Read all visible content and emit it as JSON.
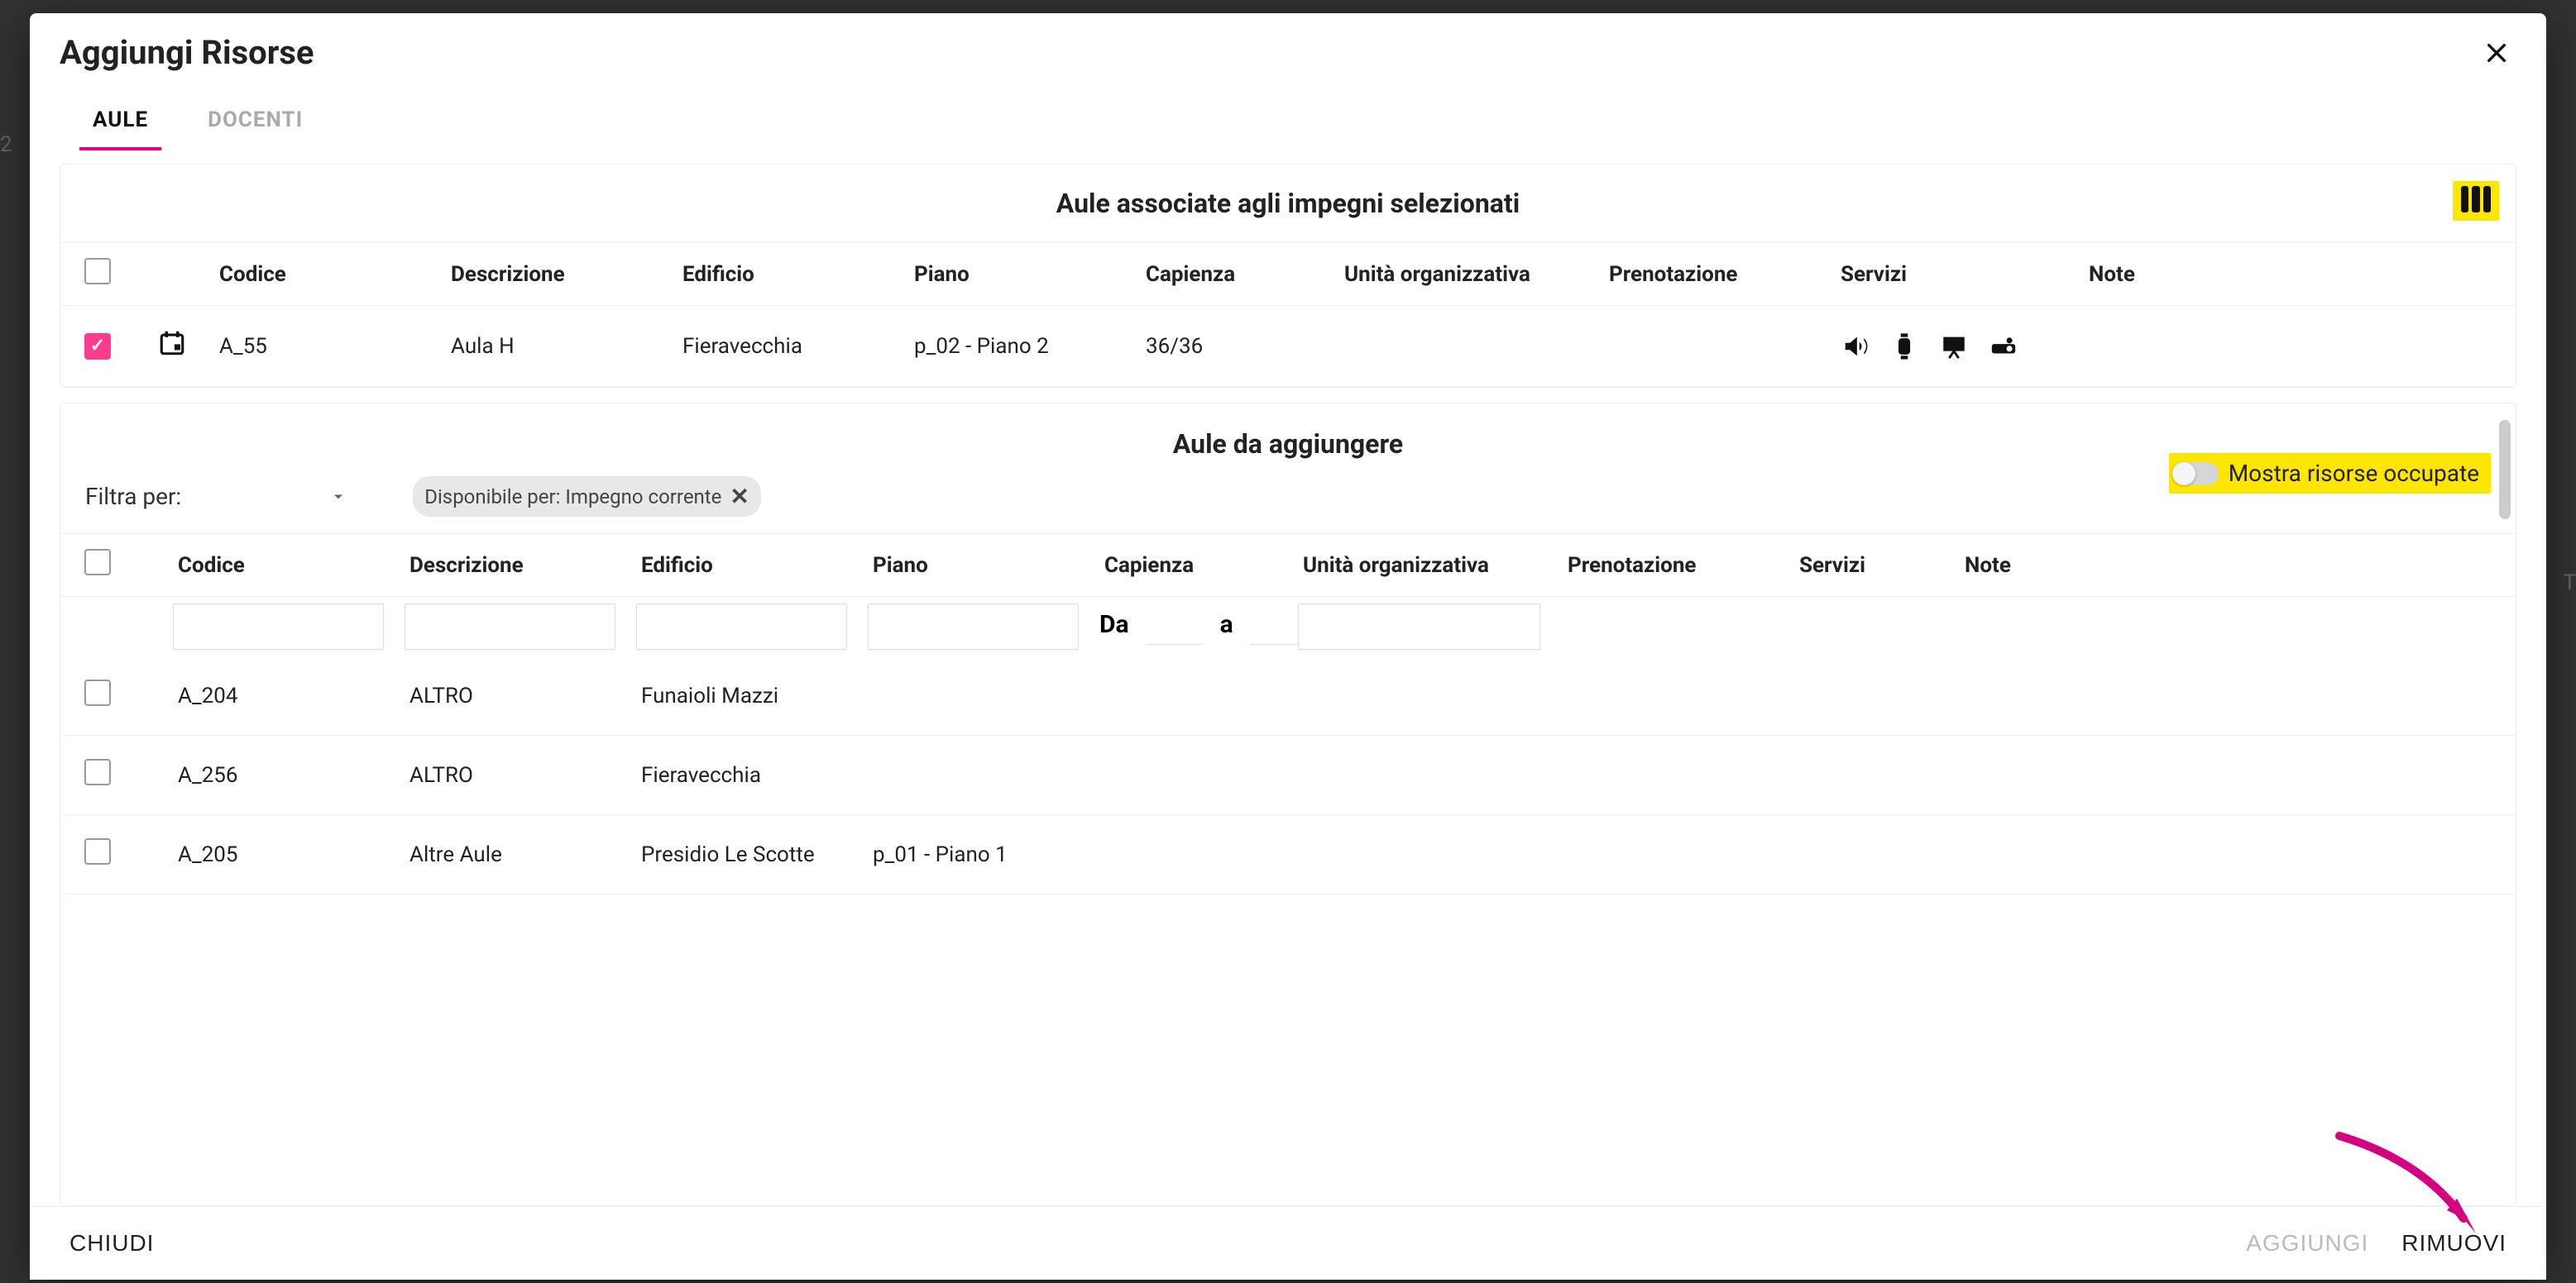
{
  "backdrop": {
    "left": "2",
    "right": "T"
  },
  "modal": {
    "title": "Aggiungi Risorse",
    "close_button": "✕"
  },
  "tabs": {
    "aule": "AULE",
    "docenti": "DOCENTI"
  },
  "panel_associated": {
    "title": "Aule associate agli impegni selezionati",
    "columns": {
      "codice": "Codice",
      "descrizione": "Descrizione",
      "edificio": "Edificio",
      "piano": "Piano",
      "capienza": "Capienza",
      "unita": "Unità organizzativa",
      "prenotazione": "Prenotazione",
      "servizi": "Servizi",
      "note": "Note"
    },
    "rows": [
      {
        "checked": true,
        "codice": "A_55",
        "descrizione": "Aula H",
        "edificio": "Fieravecchia",
        "piano": "p_02 - Piano 2",
        "capienza": "36/36"
      }
    ]
  },
  "panel_add": {
    "title": "Aule da aggiungere",
    "toggle_label": "Mostra risorse occupate",
    "filter_label": "Filtra per:",
    "chip_text": "Disponibile per: Impegno corrente",
    "chip_close": "✕",
    "columns": {
      "codice": "Codice",
      "descrizione": "Descrizione",
      "edificio": "Edificio",
      "piano": "Piano",
      "capienza": "Capienza",
      "unita": "Unità organizzativa",
      "prenotazione": "Prenotazione",
      "servizi": "Servizi",
      "note": "Note"
    },
    "cap_from": "Da",
    "cap_to": "a",
    "rows": [
      {
        "codice": "A_204",
        "descrizione": "ALTRO",
        "edificio": "Funaioli Mazzi",
        "piano": ""
      },
      {
        "codice": "A_256",
        "descrizione": "ALTRO",
        "edificio": "Fieravecchia",
        "piano": ""
      },
      {
        "codice": "A_205",
        "descrizione": "Altre Aule",
        "edificio": "Presidio Le Scotte",
        "piano": "p_01 - Piano 1"
      }
    ]
  },
  "footer": {
    "chiudi": "CHIUDI",
    "aggiungi": "AGGIUNGI",
    "rimuovi": "RIMUOVI"
  }
}
